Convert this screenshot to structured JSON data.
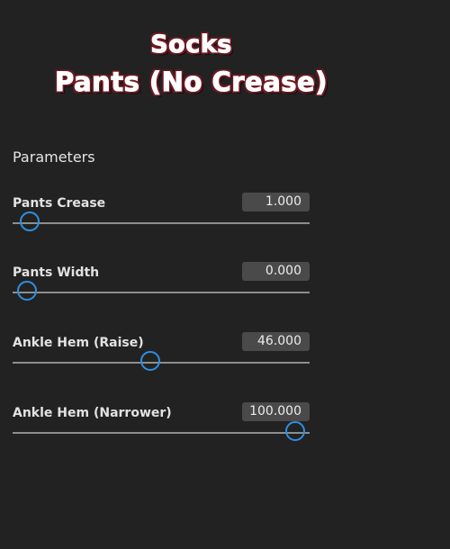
{
  "title": {
    "line1": "Socks",
    "line2": "Pants (No Crease)"
  },
  "parameters": {
    "heading": "Parameters",
    "items": [
      {
        "label": "Pants Crease",
        "value": "1.000",
        "level": 0.01
      },
      {
        "label": "Pants Width",
        "value": "0.000",
        "level": 0.0
      },
      {
        "label": "Ankle Hem (Raise)",
        "value": "46.000",
        "level": 0.46
      },
      {
        "label": "Ankle Hem (Narrower)",
        "value": "100.000",
        "level": 1.0
      }
    ]
  },
  "colors": {
    "background": "#222222",
    "accent": "#2f8fe0",
    "title_outline": "#6e1a24"
  }
}
